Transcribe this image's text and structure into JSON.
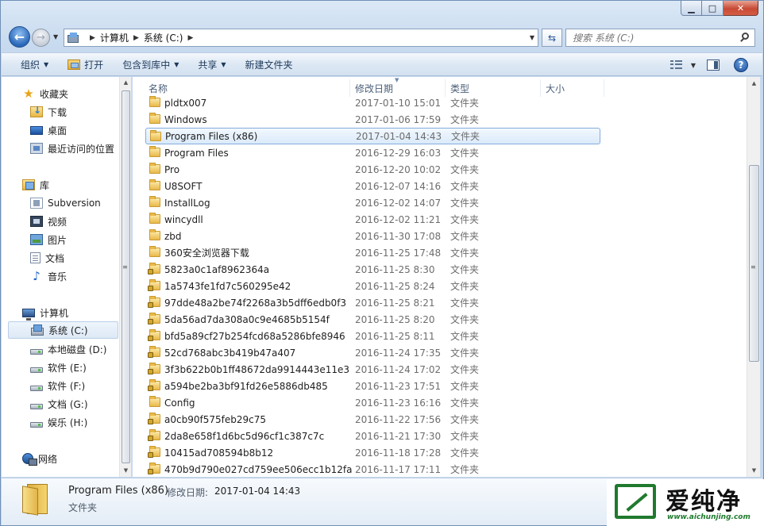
{
  "caption": {
    "minimize": "▁",
    "maximize": "□",
    "close": "✕"
  },
  "address": {
    "crumbs": [
      "计算机",
      "系统 (C:)"
    ],
    "search_placeholder": "搜索 系统 (C:)"
  },
  "toolbar": {
    "organize": "组织",
    "open": "打开",
    "include_in_library": "包含到库中",
    "share": "共享",
    "new_folder": "新建文件夹"
  },
  "sidebar": {
    "favorites": "收藏夹",
    "downloads": "下载",
    "desktop": "桌面",
    "recent": "最近访问的位置",
    "libraries": "库",
    "subversion": "Subversion",
    "videos": "视频",
    "pictures": "图片",
    "documents": "文档",
    "music": "音乐",
    "computer": "计算机",
    "drives": [
      "系统 (C:)",
      "本地磁盘 (D:)",
      "软件 (E:)",
      "软件 (F:)",
      "文档 (G:)",
      "娱乐 (H:)"
    ],
    "network": "网络"
  },
  "columns": {
    "name": "名称",
    "date": "修改日期",
    "type": "类型",
    "size": "大小"
  },
  "files": [
    {
      "name": "pldtx007",
      "date": "2017-01-10 15:01",
      "type": "文件夹"
    },
    {
      "name": "Windows",
      "date": "2017-01-06 17:59",
      "type": "文件夹"
    },
    {
      "name": "Program Files (x86)",
      "date": "2017-01-04 14:43",
      "type": "文件夹"
    },
    {
      "name": "Program Files",
      "date": "2016-12-29 16:03",
      "type": "文件夹"
    },
    {
      "name": "Pro",
      "date": "2016-12-20 10:02",
      "type": "文件夹"
    },
    {
      "name": "U8SOFT",
      "date": "2016-12-07 14:16",
      "type": "文件夹"
    },
    {
      "name": "InstallLog",
      "date": "2016-12-02 14:07",
      "type": "文件夹"
    },
    {
      "name": "wincydll",
      "date": "2016-12-02 11:21",
      "type": "文件夹"
    },
    {
      "name": "zbd",
      "date": "2016-11-30 17:08",
      "type": "文件夹"
    },
    {
      "name": "360安全浏览器下载",
      "date": "2016-11-25 17:48",
      "type": "文件夹"
    },
    {
      "name": "5823a0c1af8962364a",
      "date": "2016-11-25 8:30",
      "type": "文件夹"
    },
    {
      "name": "1a5743fe1fd7c560295e42",
      "date": "2016-11-25 8:24",
      "type": "文件夹"
    },
    {
      "name": "97dde48a2be74f2268a3b5dff6edb0f3",
      "date": "2016-11-25 8:21",
      "type": "文件夹"
    },
    {
      "name": "5da56ad7da308a0c9e4685b5154f",
      "date": "2016-11-25 8:20",
      "type": "文件夹"
    },
    {
      "name": "bfd5a89cf27b254fcd68a5286bfe8946",
      "date": "2016-11-25 8:11",
      "type": "文件夹"
    },
    {
      "name": "52cd768abc3b419b47a407",
      "date": "2016-11-24 17:35",
      "type": "文件夹"
    },
    {
      "name": "3f3b622b0b1ff48672da9914443e11e3",
      "date": "2016-11-24 17:02",
      "type": "文件夹"
    },
    {
      "name": "a594be2ba3bf91fd26e5886db485",
      "date": "2016-11-23 17:51",
      "type": "文件夹"
    },
    {
      "name": "Config",
      "date": "2016-11-23 16:16",
      "type": "文件夹"
    },
    {
      "name": "a0cb90f575feb29c75",
      "date": "2016-11-22 17:56",
      "type": "文件夹"
    },
    {
      "name": "2da8e658f1d6bc5d96cf1c387c7c",
      "date": "2016-11-21 17:30",
      "type": "文件夹"
    },
    {
      "name": "10415ad708594b8b12",
      "date": "2016-11-18 17:28",
      "type": "文件夹"
    },
    {
      "name": "470b9d790e027cd759ee506ecc1b12fa",
      "date": "2016-11-17 17:11",
      "type": "文件夹"
    }
  ],
  "details": {
    "name": "Program Files (x86)",
    "date_label": "修改日期:",
    "date": "2017-01-04 14:43",
    "type": "文件夹"
  },
  "watermark": {
    "text": "爱纯净",
    "url": "www.aichunjing.com"
  }
}
